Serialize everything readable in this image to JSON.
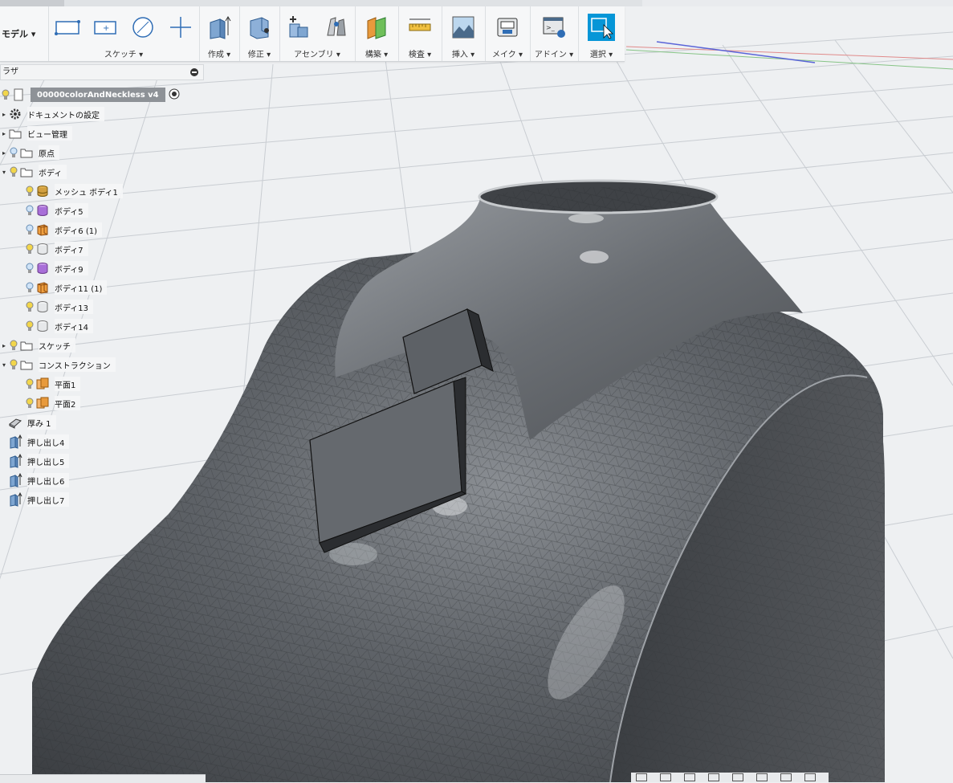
{
  "toolbar": {
    "workspace_label": "モデル ▾",
    "groups": [
      {
        "label": "スケッチ ▾"
      },
      {
        "label": "作成 ▾"
      },
      {
        "label": "修正 ▾"
      },
      {
        "label": "アセンブリ ▾"
      },
      {
        "label": "構築 ▾"
      },
      {
        "label": "検査 ▾"
      },
      {
        "label": "挿入 ▾"
      },
      {
        "label": "メイク ▾"
      },
      {
        "label": "アドイン ▾"
      },
      {
        "label": "選択 ▾"
      }
    ]
  },
  "browser": {
    "header_label": "ラザ",
    "root": {
      "label": "00000colorAndNeckless v4"
    },
    "nodes": [
      {
        "label": "ドキュメントの設定",
        "icon": "gear-icon"
      },
      {
        "label": "ビュー管理",
        "icon": "folder-icon"
      },
      {
        "label": "原点",
        "icon": "folder-icon"
      },
      {
        "label": "ボディ",
        "icon": "folder-icon"
      },
      {
        "label": "メッシュ ボディ1",
        "icon": "mesh-body-icon"
      },
      {
        "label": "ボディ5",
        "icon": "body-icon"
      },
      {
        "label": "ボディ6 (1)",
        "icon": "body-icon"
      },
      {
        "label": "ボディ7",
        "icon": "body-icon"
      },
      {
        "label": "ボディ9",
        "icon": "body-icon"
      },
      {
        "label": "ボディ11 (1)",
        "icon": "body-icon"
      },
      {
        "label": "ボディ13",
        "icon": "body-icon"
      },
      {
        "label": "ボディ14",
        "icon": "body-icon"
      },
      {
        "label": "スケッチ",
        "icon": "folder-icon"
      },
      {
        "label": "コンストラクション",
        "icon": "folder-icon"
      },
      {
        "label": "平面1",
        "icon": "plane-icon"
      },
      {
        "label": "平面2",
        "icon": "plane-icon"
      },
      {
        "label": "厚み 1",
        "icon": "thicken-icon"
      },
      {
        "label": "押し出し4",
        "icon": "extrude-icon"
      },
      {
        "label": "押し出し5",
        "icon": "extrude-icon"
      },
      {
        "label": "押し出し6",
        "icon": "extrude-icon"
      },
      {
        "label": "押し出し7",
        "icon": "extrude-icon"
      }
    ]
  },
  "colors": {
    "accent": "#0696d7",
    "mesh_body": "#55595e",
    "solid_body": "#5c6065",
    "grid_line": "#c9cdd2"
  }
}
